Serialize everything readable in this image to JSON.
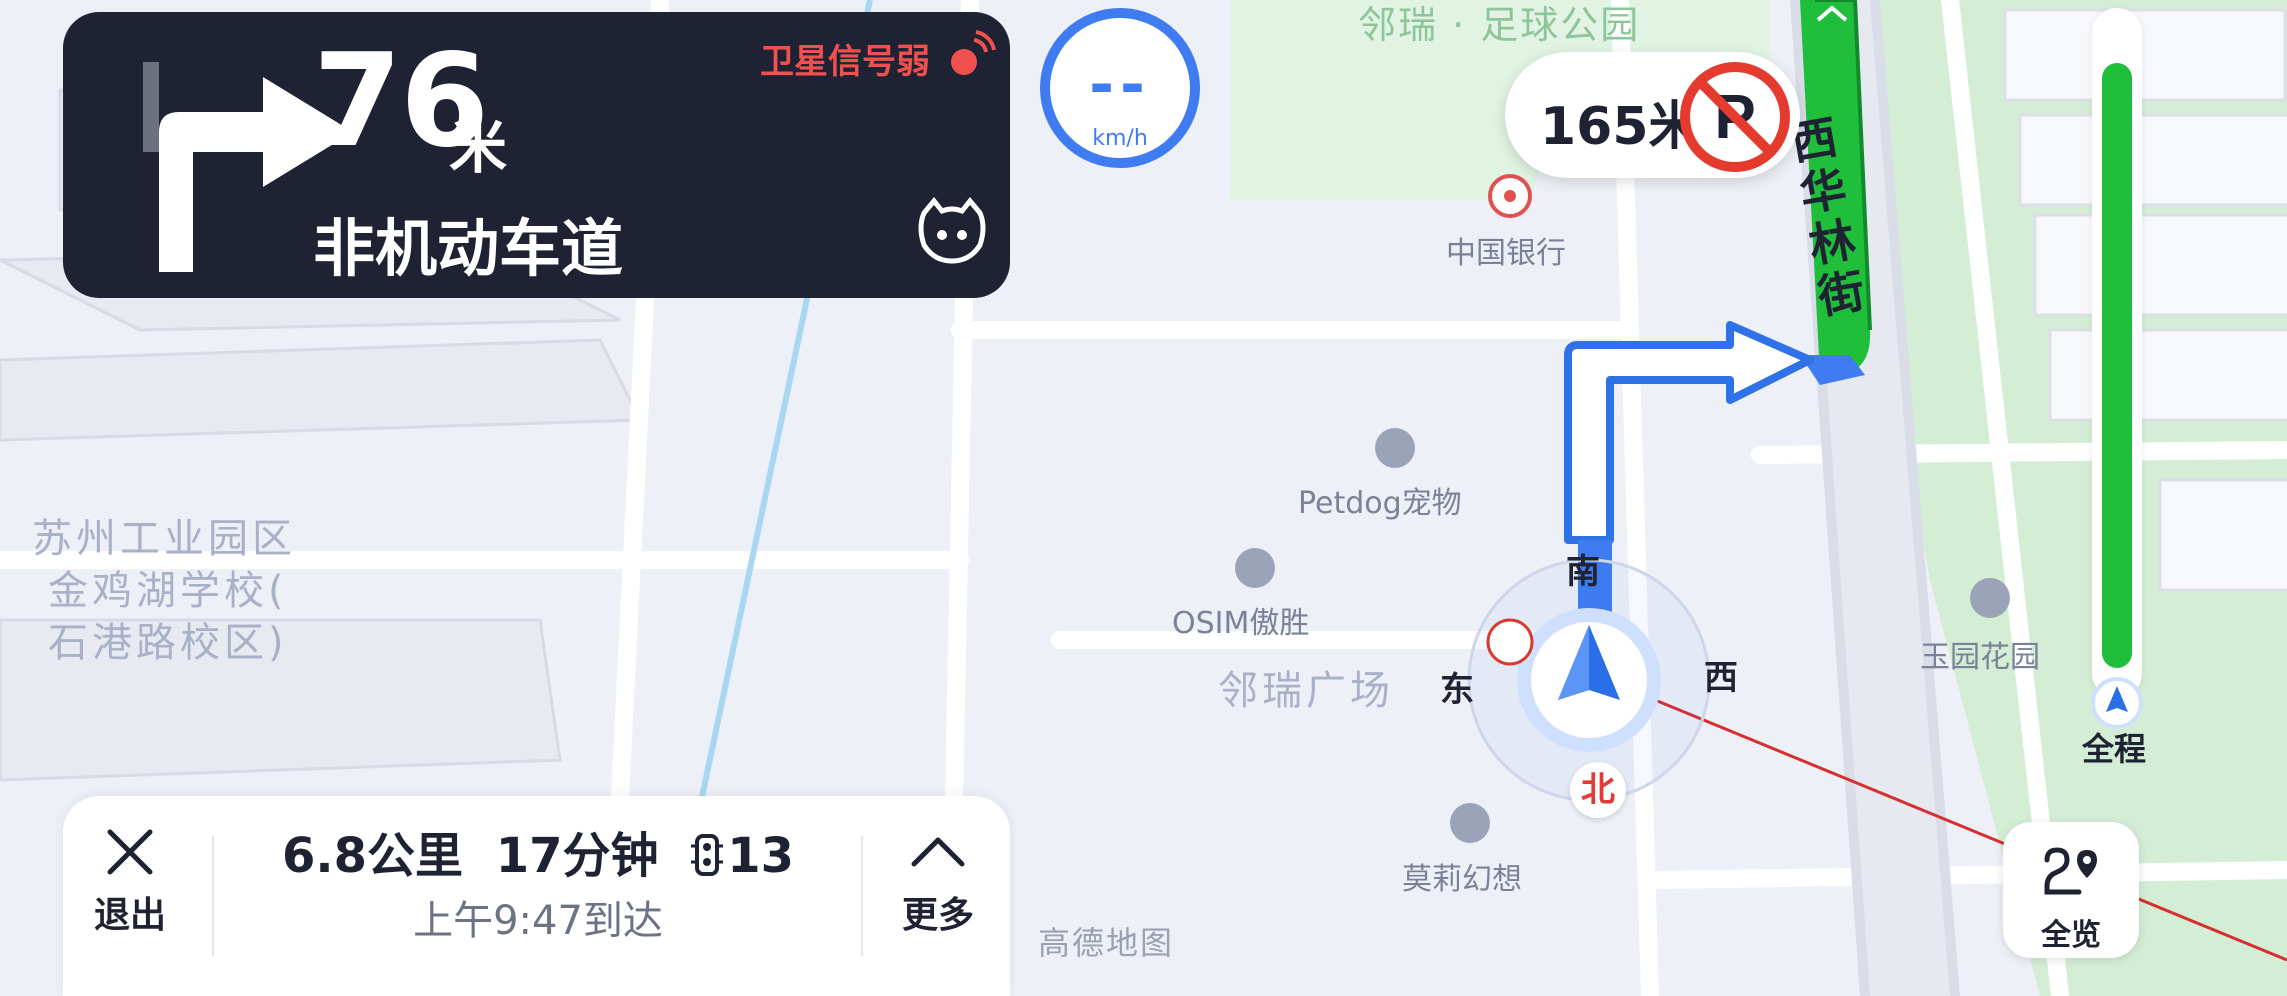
{
  "guidance": {
    "distance": "76",
    "distance_unit": "米",
    "road_name": "非机动车道",
    "gps_status": "卫星信号弱",
    "maneuver_icon": "turn-right-arrow"
  },
  "speed": {
    "value": "--",
    "unit": "km/h"
  },
  "restriction": {
    "distance": "165米",
    "icon": "no-parking-sign"
  },
  "street": "西华林街",
  "pois": {
    "park": "邻瑞 · 足球公园",
    "bank": "中国银行",
    "pet": "Petdog宠物",
    "osim": "OSIM傲胜",
    "plaza": "邻瑞广场",
    "moli": "莫莉幻想",
    "garden": "玉园花园",
    "school": [
      "苏州工业园区",
      "金鸡湖学校(",
      "石港路校区)"
    ]
  },
  "compass": {
    "south": "南",
    "east": "东",
    "west": "西",
    "north": "北"
  },
  "trip": {
    "exit_label": "退出",
    "distance": "6.8公里",
    "duration": "17分钟",
    "traffic_lights": "13",
    "arrival": "上午9:47到达",
    "more_label": "更多"
  },
  "progress": {
    "label": "全程",
    "completed_fraction": 0.04
  },
  "overview_label": "全览",
  "watermark": "高德地图",
  "colors": {
    "route_green": "#1fbf3c",
    "accent_blue": "#3f7cf2",
    "warning_red": "#f0514e",
    "card_dark": "#1e2232"
  }
}
